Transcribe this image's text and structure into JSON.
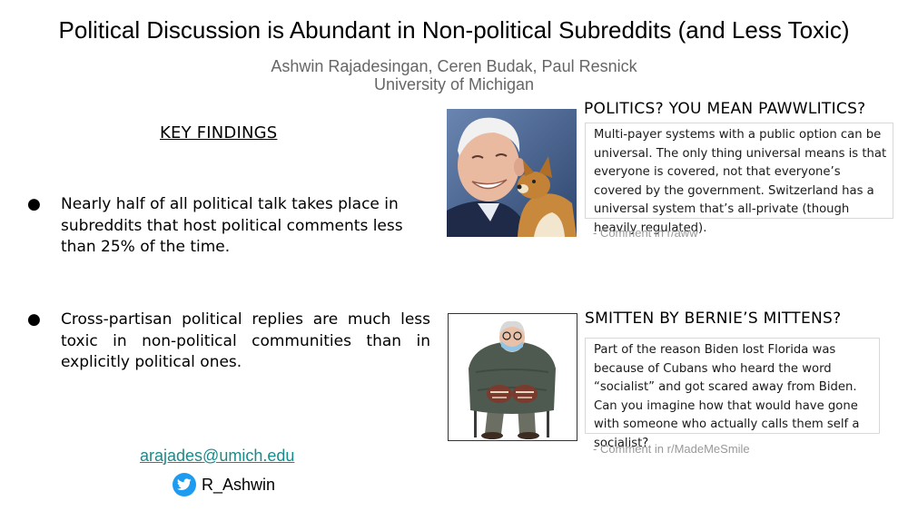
{
  "header": {
    "title": "Political Discussion is Abundant in Non-political Subreddits (and Less Toxic)",
    "authors": "Ashwin Rajadesingan, Ceren Budak, Paul Resnick",
    "affiliation": "University of Michigan"
  },
  "key_findings": {
    "heading": "KEY FINDINGS",
    "bullet": "●",
    "items": [
      "Nearly half of all political talk takes place in subreddits that host political comments less than 25% of the time.",
      "Cross-partisan political replies are much less toxic in non-political communities than in explicitly political ones."
    ]
  },
  "contact": {
    "email": "arajades@umich.edu",
    "twitter_handle": "R_Ashwin",
    "twitter_color": "#1d9bf0"
  },
  "examples": [
    {
      "heading": "POLITICS? YOU MEAN PAWWLITICS?",
      "comment": "Multi-payer systems with a public option can be universal. The only thing universal means is that everyone is covered, not that everyone’s covered by the government. Switzerland has a universal system that’s all-private (though heavily regulated).",
      "source": "- Comment in r/aww"
    },
    {
      "heading": "SMITTEN BY BERNIE’S MITTENS?",
      "comment": "Part of the reason Biden lost Florida was because of Cubans who heard the word “socialist” and got scared away from Biden. Can you imagine how that would have gone with someone who actually calls them self a socialist?",
      "source": "- Comment in r/MadeMeSmile"
    }
  ]
}
